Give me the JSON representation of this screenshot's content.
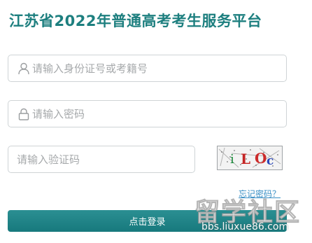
{
  "header": {
    "title": "江苏省2022年普通高考考生服务平台"
  },
  "form": {
    "id_field": {
      "placeholder": "请输入身份证号或考籍号",
      "value": "",
      "icon": "user-icon"
    },
    "password_field": {
      "placeholder": "请输入密码",
      "value": "",
      "icon": "lock-icon"
    },
    "captcha_field": {
      "placeholder": "请输入验证码",
      "value": ""
    },
    "captcha_image": {
      "text": "iLOc"
    },
    "forgot_password": "忘记密码？",
    "login_button": "点击登录"
  },
  "watermark": {
    "brand": "留学社区",
    "url": "bbs.liuxue86.com"
  },
  "colors": {
    "title": "#1d7f7f",
    "button": "#1f8488",
    "link": "#3a8fc5",
    "border": "#cfd4d6",
    "placeholder": "#a6a9ab"
  }
}
